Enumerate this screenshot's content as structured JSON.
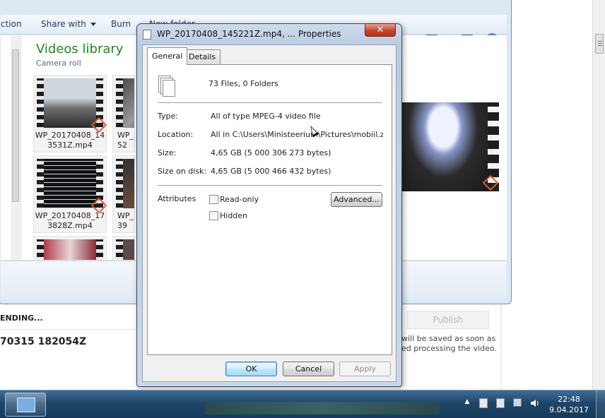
{
  "explorer": {
    "toolbar": {
      "action_partial": "ction",
      "share_with": "Share with",
      "burn": "Burn",
      "new_folder_partial": "New folder"
    },
    "library_title": "Videos library",
    "library_subtitle": "Camera roll",
    "thumbnails": [
      {
        "line1": "WP_20170408_14",
        "line2": "3531Z.mp4"
      },
      {
        "line1": "WP_",
        "line2": "52"
      },
      {
        "line1": "WP_20170408_17",
        "line2": "3828Z.mp4"
      },
      {
        "line1": "WP_",
        "line2": "39"
      }
    ]
  },
  "background_form": {
    "status": "ENDING...",
    "video_title": "70315 182054Z",
    "publish_label": "Publish",
    "note_line1": "will be saved as soon as",
    "note_line2": "ed processing the video."
  },
  "dialog": {
    "title": "WP_20170408_145221Z.mp4, ... Properties",
    "close_glyph": "✕",
    "tabs": [
      {
        "label": "General",
        "active": true
      },
      {
        "label": "Details",
        "active": false
      }
    ],
    "summary": "73 Files, 0 Folders",
    "properties": [
      {
        "label": "Type:",
        "value": "All of type MPEG-4 video file"
      },
      {
        "label": "Location:",
        "value": "All in C:\\Users\\Ministeerium\\Pictures\\mobiil.zune.pic"
      },
      {
        "label": "Size:",
        "value": "4,65 GB (5 000 306 273 bytes)"
      },
      {
        "label": "Size on disk:",
        "value": "4,65 GB (5 000 466 432 bytes)"
      }
    ],
    "attributes_label": "Attributes",
    "readonly_label": "Read-only",
    "hidden_label": "Hidden",
    "advanced_label": "Advanced...",
    "ok_label": "OK",
    "cancel_label": "Cancel",
    "apply_label": "Apply"
  },
  "taskbar": {
    "time": "22:48",
    "date": "9.04.2017",
    "tray_chevron": "▲"
  },
  "colors": {
    "library_title": "#1d8a1d",
    "taskbar": "#1f4668",
    "close_button": "#c8452f"
  }
}
